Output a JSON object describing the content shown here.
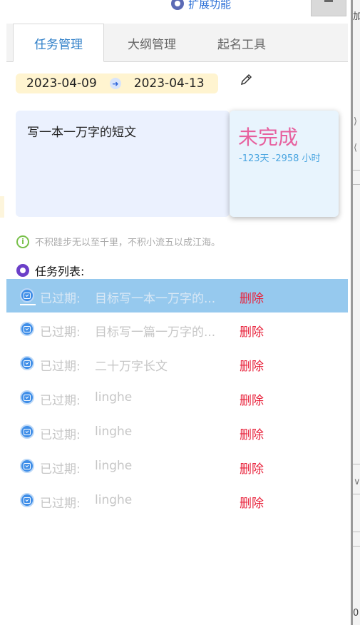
{
  "header": {
    "extension_link": "扩展功能"
  },
  "tabs": [
    {
      "label": "任务管理",
      "active": true
    },
    {
      "label": "大纲管理",
      "active": false
    },
    {
      "label": "起名工具",
      "active": false
    }
  ],
  "date_range": {
    "start": "2023-04-09",
    "end": "2023-04-13"
  },
  "current_task": {
    "text": "写一本一万字的短文",
    "status": "未完成",
    "remaining": "-123天 -2958 小时"
  },
  "motto": "不积跬步无以至千里，不积小流五以成江海。",
  "task_list": {
    "title": "任务列表:",
    "items": [
      {
        "state": "已过期:",
        "name": "目标写一本一万字的...",
        "delete": "删除",
        "highlighted": true
      },
      {
        "state": "已过期:",
        "name": "目标写一篇一万字的...",
        "delete": "删除",
        "highlighted": false
      },
      {
        "state": "已过期:",
        "name": "二十万字长文",
        "delete": "删除",
        "highlighted": false
      },
      {
        "state": "已过期:",
        "name": "linghe",
        "delete": "删除",
        "highlighted": false
      },
      {
        "state": "已过期:",
        "name": "linghe",
        "delete": "删除",
        "highlighted": false
      },
      {
        "state": "已过期:",
        "name": "linghe",
        "delete": "删除",
        "highlighted": false
      },
      {
        "state": "已过期:",
        "name": "linghe",
        "delete": "删除",
        "highlighted": false
      }
    ]
  },
  "host_page": {
    "edge_top": "加",
    "edge_bottom": "0"
  },
  "colors": {
    "accent": "#2f7fc8",
    "status": "#e7609e",
    "delete": "#e8233c",
    "highlight": "#96c9ee"
  }
}
